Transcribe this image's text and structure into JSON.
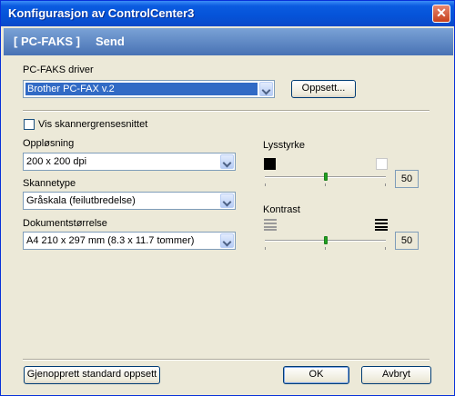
{
  "window": {
    "title": "Konfigurasjon av ControlCenter3",
    "close_glyph": "✕"
  },
  "header": {
    "tab": "[ PC-FAKS ]",
    "sub": "Send"
  },
  "driver": {
    "label": "PC-FAKS driver",
    "value": "Brother PC-FAX v.2",
    "setup_button": "Oppsett..."
  },
  "scanner_ui": {
    "label": "Vis skannergrensesnittet",
    "checked": false
  },
  "resolution": {
    "label": "Oppløsning",
    "value": "200 x 200 dpi"
  },
  "scan_type": {
    "label": "Skannetype",
    "value": "Gråskala (feilutbredelse)"
  },
  "doc_size": {
    "label": "Dokumentstørrelse",
    "value": "A4 210 x 297 mm (8.3 x 11.7 tommer)"
  },
  "brightness": {
    "label": "Lysstyrke",
    "value": "50",
    "level_percent": 50
  },
  "contrast": {
    "label": "Kontrast",
    "value": "50",
    "level_percent": 50
  },
  "footer": {
    "restore_button": "Gjenopprett standard oppsett",
    "ok_button": "OK",
    "cancel_button": "Avbryt"
  },
  "colors": {
    "title_bar": "#0553d8",
    "header_band": "#5a82c2",
    "slider_thumb": "#21a121",
    "selection": "#316ac5"
  }
}
